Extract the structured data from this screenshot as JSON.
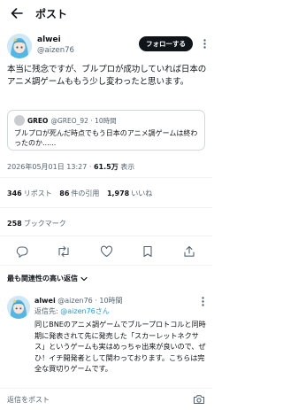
{
  "header": {
    "title": "ポスト",
    "back_icon": "arrow-left-icon"
  },
  "post": {
    "author_name": "alwei",
    "author_handle": "@aizen76",
    "follow_label": "フォローする",
    "text": "本当に残念ですが、ブルプロが成功していれば日本のアニメ調ゲームももう少し変わったと思います。",
    "quote": {
      "name": "GREO",
      "handle_time": "@GREO_92 · 10時間",
      "text": "ブルプロが死んだ時点でもう日本のアニメ調ゲームは終わったのか......"
    },
    "timestamp": "2026年05月01日 13:27 · ",
    "views_count": "61.5万",
    "views_label": " 表示"
  },
  "stats": {
    "reposts_count": "346",
    "reposts_label": "リポスト",
    "quotes_count": "86",
    "quotes_label": "件の引用",
    "likes_count": "1,978",
    "likes_label": "いいね",
    "bookmarks_count": "258",
    "bookmarks_label": "ブックマーク"
  },
  "actions": [
    "reply-icon",
    "repost-icon",
    "like-icon",
    "bookmark-icon",
    "share-icon"
  ],
  "replies_section": {
    "title": "最も関連性の高い返信"
  },
  "reply": {
    "author_name": "alwei",
    "handle_time": " @aizen76 · 10時間",
    "reply_to_label": "返信先: ",
    "reply_to_handle": "@aizen76さん",
    "text": "同じBNEのアニメ調ゲームでブループロトコルと同時期に発表されて先に発売した「スカーレットネクサス」というゲームも実はめっちゃ出来が良いので、ぜひ！イチ開発者として関わっております。こちらは完全な買切りゲームです。"
  },
  "composer": {
    "placeholder": "返信をポスト"
  },
  "colors": {
    "accent": "#1d9bf0",
    "text": "#0f1419",
    "muted": "#536471",
    "border": "#cfd9de"
  }
}
